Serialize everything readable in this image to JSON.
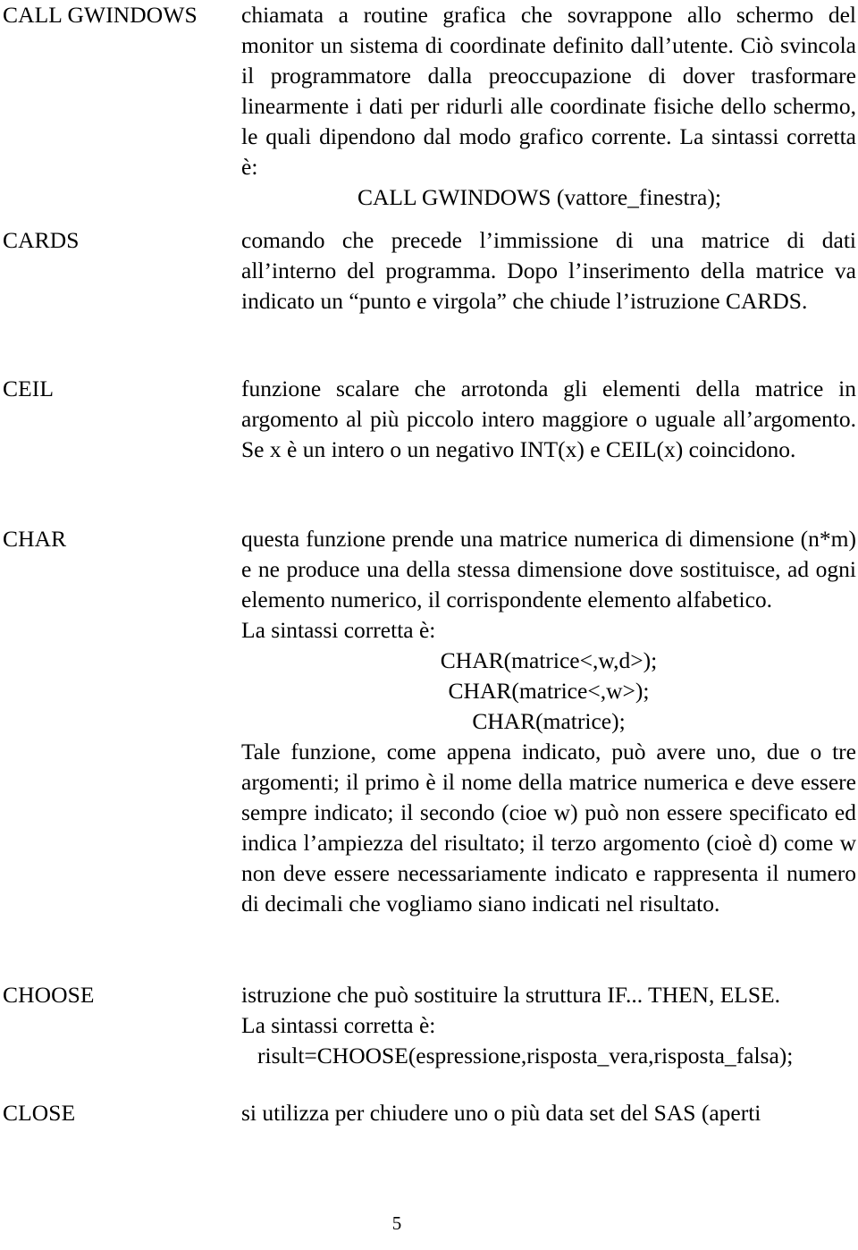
{
  "document": {
    "page_number": "5",
    "entries": [
      {
        "term": "CALL GWINDOWS",
        "blocks": [
          {
            "kind": "paragraph",
            "text": "chiamata a routine grafica che sovrappone allo schermo del monitor un sistema di coordinate definito  dall’utente. Ciò svincola il programmatore dalla preoccupazione di dover trasformare linearmente i dati per ridurli alle coordinate fisiche dello  schermo, le quali dipendono dal  modo grafico corrente. La sintassi corretta è:"
          },
          {
            "kind": "syntax",
            "indent": "130",
            "text": "CALL GWINDOWS (vattore_finestra);"
          }
        ]
      },
      {
        "term": "CARDS",
        "blocks": [
          {
            "kind": "paragraph",
            "text": "comando che precede l’immissione di una matrice di dati all’interno del programma. Dopo l’inserimento della matrice va indicato un “punto e virgola” che chiude l’istruzione CARDS."
          }
        ]
      },
      {
        "term": "CEIL",
        "blocks": [
          {
            "kind": "paragraph",
            "text": "funzione scalare che arrotonda gli elementi della matrice in argomento al più piccolo intero maggiore o uguale all’argomento. Se x è  un intero o un negativo INT(x) e CEIL(x) coincidono."
          }
        ]
      },
      {
        "term": "CHAR",
        "blocks": [
          {
            "kind": "paragraph",
            "text": "questa funzione prende una matrice numerica di dimensione (n*m) e ne produce una della stessa dimensione dove sostituisce, ad ogni elemento numerico, il corrispondente elemento alfabetico."
          },
          {
            "kind": "plain",
            "text": "La sintassi corretta è:"
          },
          {
            "kind": "syntax",
            "indent": "center",
            "text": "CHAR(matrice<,w,d>);"
          },
          {
            "kind": "syntax",
            "indent": "center",
            "text": "CHAR(matrice<,w>);"
          },
          {
            "kind": "syntax",
            "indent": "center",
            "text": "CHAR(matrice);"
          },
          {
            "kind": "paragraph",
            "text": "Tale funzione, come appena indicato, può avere uno, due o tre argomenti; il primo è il nome della matrice numerica e deve essere sempre indicato; il secondo (cioe w) può non essere specificato ed indica l’ampiezza del risultato; il terzo argomento (cioè d) come w non deve essere necessariamente indicato e rappresenta il numero di decimali che vogliamo siano indicati nel risultato."
          }
        ]
      },
      {
        "term": "CHOOSE",
        "blocks": [
          {
            "kind": "plain",
            "text": "istruzione che può sostituire la struttura IF... THEN, ELSE."
          },
          {
            "kind": "plain",
            "text": "La sintassi corretta è:"
          },
          {
            "kind": "syntax",
            "indent": "18",
            "text": "risult=CHOOSE(espressione,risposta_vera,risposta_falsa);"
          }
        ]
      },
      {
        "term": "CLOSE",
        "blocks": [
          {
            "kind": "plain",
            "text": "si utilizza per chiudere uno o più data set del SAS (aperti"
          }
        ]
      }
    ]
  }
}
